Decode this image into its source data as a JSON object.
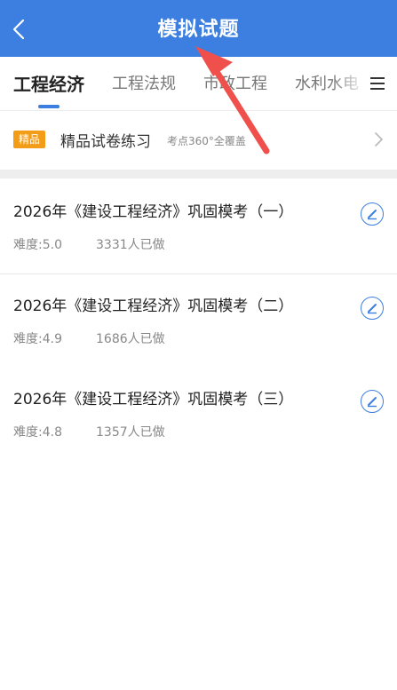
{
  "header": {
    "title": "模拟试题",
    "back_icon": "chevron-left-icon",
    "background": "#3d7fe0"
  },
  "tabs": {
    "items": [
      {
        "label": "工程经济",
        "active": true
      },
      {
        "label": "工程法规",
        "active": false
      },
      {
        "label": "市政工程",
        "active": false
      },
      {
        "label": "水利水电",
        "active": false
      }
    ],
    "menu_icon": "hamburger-menu-icon"
  },
  "banner": {
    "badge": "精品",
    "title": "精品试卷练习",
    "subtitle": "考点360°全覆盖",
    "arrow_icon": "chevron-right-icon"
  },
  "papers": [
    {
      "title": "2026年《建设工程经济》巩固模考（一）",
      "difficulty": "难度:5.0",
      "done": "3331人已做"
    },
    {
      "title": "2026年《建设工程经济》巩固模考（二）",
      "difficulty": "难度:4.9",
      "done": "1686人已做"
    },
    {
      "title": "2026年《建设工程经济》巩固模考（三）",
      "difficulty": "难度:4.8",
      "done": "1357人已做"
    }
  ],
  "colors": {
    "accent": "#3d7fe0",
    "badge": "#f39c18",
    "annotation_arrow": "#f0504b"
  }
}
